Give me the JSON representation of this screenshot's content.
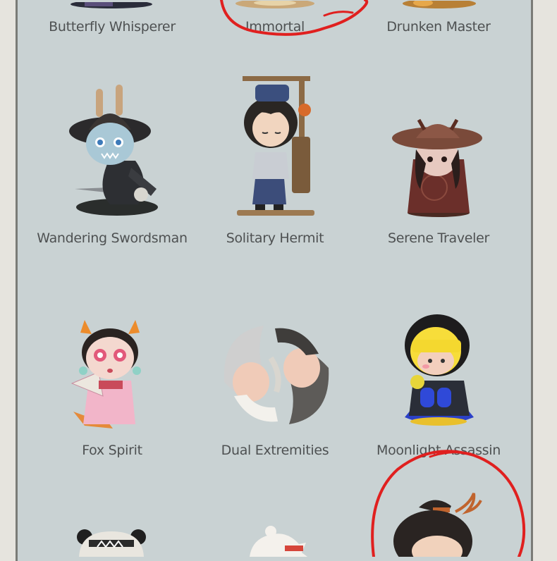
{
  "rows": [
    {
      "items": [
        {
          "name": "Butterfly Whisperer"
        },
        {
          "name": "Immortal"
        },
        {
          "name": "Drunken Master"
        }
      ]
    },
    {
      "items": [
        {
          "name": "Wandering Swordsman"
        },
        {
          "name": "Solitary Hermit"
        },
        {
          "name": "Serene Traveler"
        }
      ]
    },
    {
      "items": [
        {
          "name": "Fox Spirit"
        },
        {
          "name": "Dual Extremities"
        },
        {
          "name": "Moonlight Assassin"
        }
      ]
    }
  ],
  "colors": {
    "panel": "#c9d2d3",
    "border": "#7a7b77",
    "marker": "#e0201f",
    "label_text": "#4e5152"
  }
}
